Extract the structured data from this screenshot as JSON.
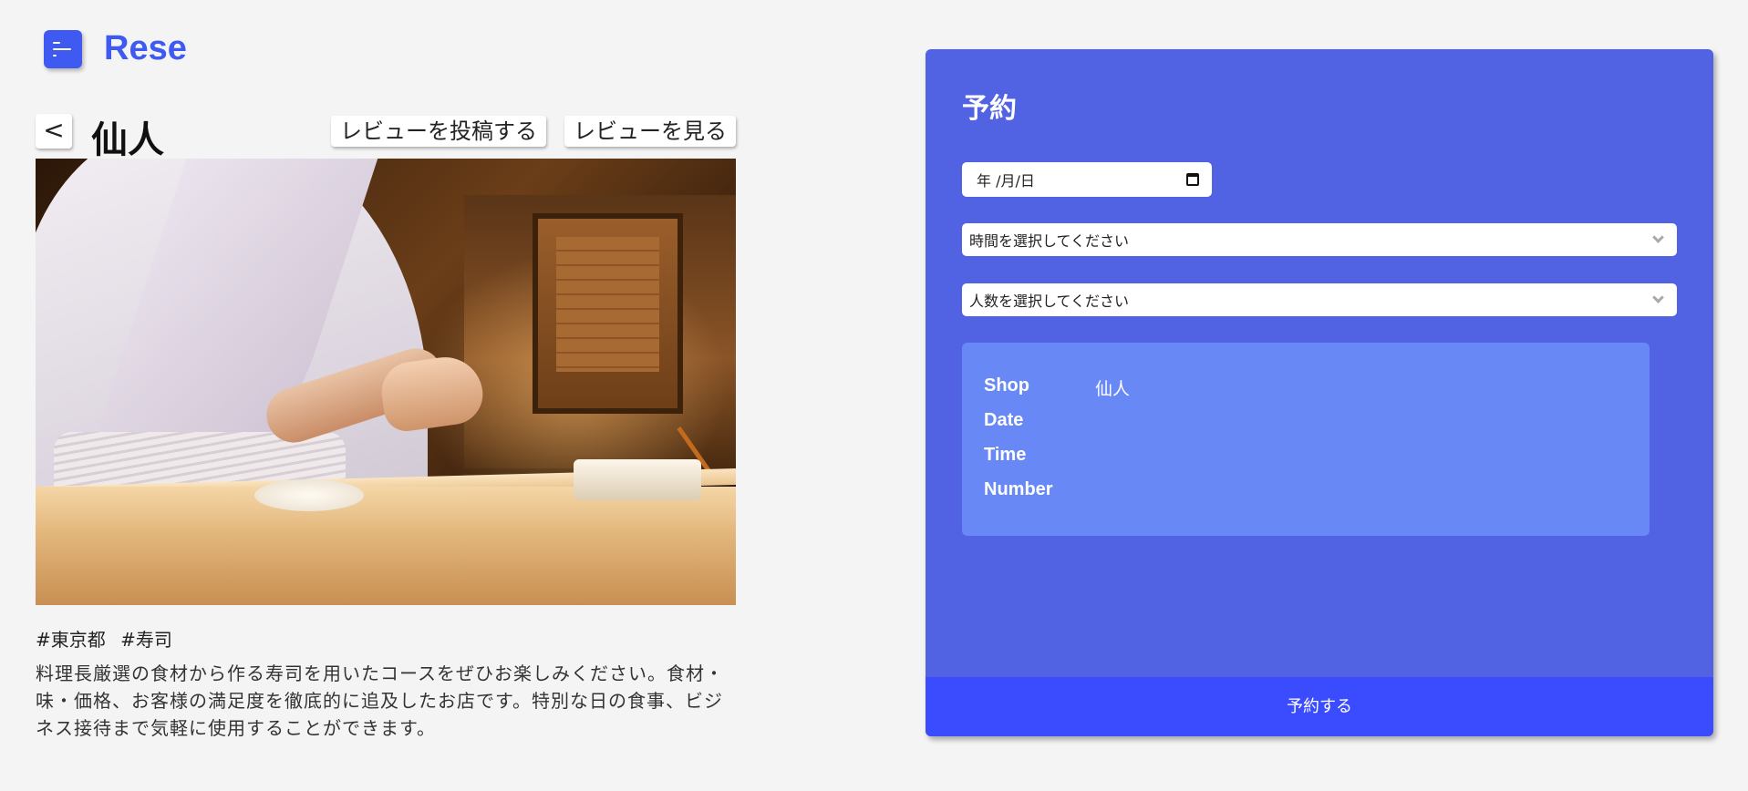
{
  "header": {
    "logo": "Rese",
    "menu_icon": "hamburger-menu-icon",
    "accent_color": "#3f5af0"
  },
  "shop": {
    "back_label": "<",
    "name": "仙人",
    "post_review_label": "レビューを投稿する",
    "view_review_label": "レビューを見る",
    "image_subject": "shop-photo",
    "tags": [
      "#東京都",
      "#寿司"
    ],
    "description": "料理長厳選の食材から作る寿司を用いたコースをぜひお楽しみください。食材・味・価格、お客様の満足度を徹底的に追及したお店です。特別な日の食事、ビジネス接待まで気軽に使用することができます。"
  },
  "reservation": {
    "title": "予約",
    "date_placeholder": "年 /月/日",
    "time_placeholder": "時間を選択してください",
    "number_placeholder": "人数を選択してください",
    "summary": {
      "shop_label": "Shop",
      "shop_value": "仙人",
      "date_label": "Date",
      "date_value": "",
      "time_label": "Time",
      "time_value": "",
      "number_label": "Number",
      "number_value": ""
    },
    "submit_label": "予約する",
    "panel_color": "#5162e3",
    "summary_color": "#6889f5",
    "button_color": "#3b4cff"
  }
}
